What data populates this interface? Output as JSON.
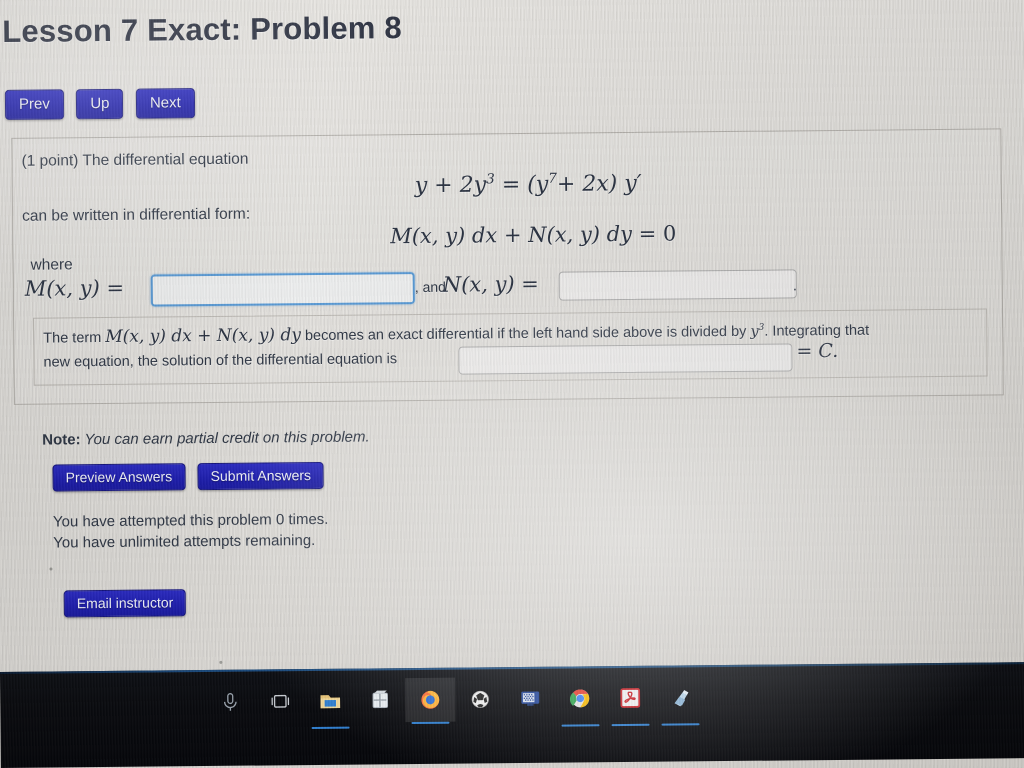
{
  "header": {
    "title": "Lesson 7 Exact: Problem 8",
    "nav": [
      {
        "label": "Prev",
        "name": "prev-button"
      },
      {
        "label": "Up",
        "name": "up-button"
      },
      {
        "label": "Next",
        "name": "next-button"
      }
    ]
  },
  "problem": {
    "points_and_intro": "(1 point) The differential equation",
    "equation_main": {
      "lhs_y": "y",
      "plus": "+",
      "two_y_cubed": "2y",
      "two_y_cubed_exp": "3",
      "equals": "=",
      "rhs": "(y",
      "rhs_exp": "7",
      "rhs_tail": "+ 2x) y′",
      "plain": "y + 2y^3 = (y^7 + 2x) y'"
    },
    "written_in_form": "can be written in differential form:",
    "equation_form": {
      "plain": "M(x, y) dx + N(x, y) dy = 0",
      "m_part": "M(x, y) dx",
      "plus": "+",
      "n_part": "N(x, y) dy",
      "equals_zero": "= 0"
    },
    "where_label": "where",
    "m_label": "M(x, y) =",
    "m_input_value": "",
    "m_input_placeholder": "",
    "and_label": ", and",
    "n_label": "N(x, y) =",
    "n_input_value": "",
    "n_input_placeholder": "",
    "trailing_period": ".",
    "exact_text_part1": "The term",
    "exact_math": "M(x, y) dx + N(x, y) dy",
    "exact_text_part2": "becomes an exact differential if the left hand side above is divided by",
    "divisor": "y",
    "divisor_exp": "3",
    "exact_text_part3": ". Integrating that",
    "solution_text": "new equation, the solution of the differential equation is",
    "solution_input_value": "",
    "solution_input_placeholder": "",
    "equals_c": "= C."
  },
  "footer": {
    "note_bold": "Note:",
    "note_text": "You can earn partial credit on this problem.",
    "preview_label": "Preview Answers",
    "submit_label": "Submit Answers",
    "attempts_line1": "You have attempted this problem 0 times.",
    "attempts_line2": "You have unlimited attempts remaining.",
    "email_label": "Email instructor"
  },
  "taskbar": {
    "items": [
      {
        "name": "cortana-microphone-icon",
        "kind": "mic",
        "active": false,
        "running": false
      },
      {
        "name": "task-view-icon",
        "kind": "taskview",
        "active": false,
        "running": false
      },
      {
        "name": "file-explorer-icon",
        "kind": "folder",
        "active": false,
        "running": true
      },
      {
        "name": "microsoft-store-icon",
        "kind": "store",
        "active": false,
        "running": false
      },
      {
        "name": "firefox-icon",
        "kind": "firefox",
        "active": true,
        "running": true
      },
      {
        "name": "soccer-ball-app-icon",
        "kind": "ball",
        "active": false,
        "running": false
      },
      {
        "name": "remote-desktop-icon",
        "kind": "monitor",
        "active": false,
        "running": false
      },
      {
        "name": "google-chrome-icon",
        "kind": "chrome",
        "active": false,
        "running": true
      },
      {
        "name": "adobe-acrobat-icon",
        "kind": "acrobat",
        "active": false,
        "running": true
      },
      {
        "name": "onenote-notebook-icon",
        "kind": "notebook",
        "active": false,
        "running": true
      }
    ]
  },
  "colors": {
    "button_blue": "#1f1fae",
    "text_dark": "#2f3745",
    "focus_border": "#5b9bd5",
    "panel_border": "#b3b0ab",
    "taskbar_bg": "#07080c"
  }
}
